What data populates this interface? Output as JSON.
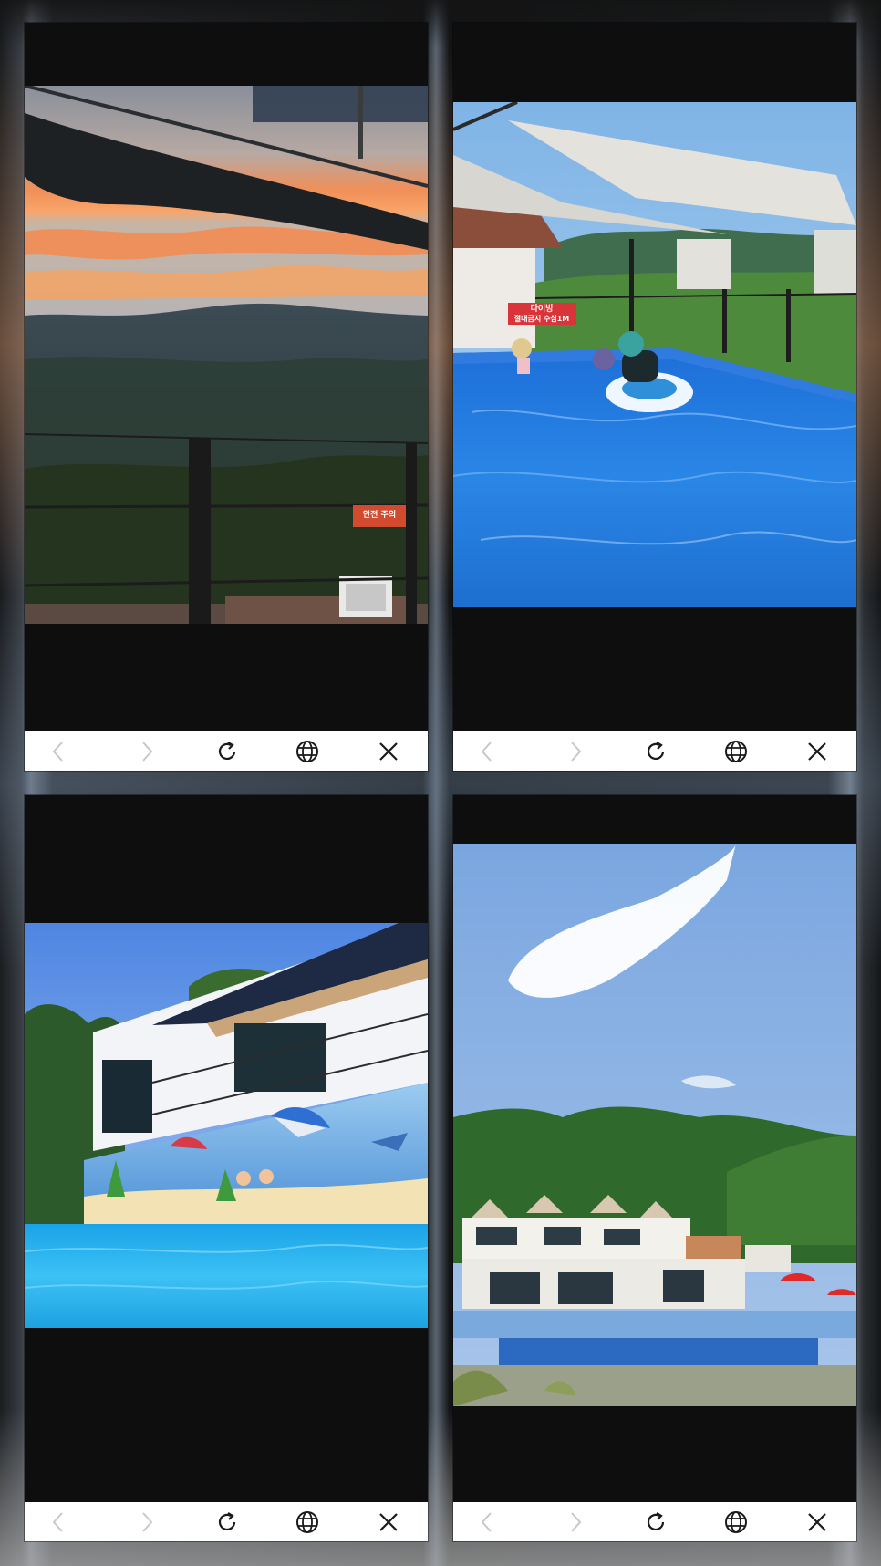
{
  "toolbar": {
    "back_icon": "chevron-left-icon",
    "forward_icon": "chevron-right-icon",
    "reload_icon": "reload-icon",
    "globe_icon": "globe-icon",
    "close_icon": "close-icon",
    "icon_color": "#1a1a1a",
    "disabled_color": "#c8c8c8"
  },
  "panels": [
    {
      "id": "sunset-mountain-view",
      "sign_text": "안전 주의"
    },
    {
      "id": "rooftop-pool",
      "sign_text_line1": "다이빙",
      "sign_text_line2": "절대금지  수심1M"
    },
    {
      "id": "mural-pool-building"
    },
    {
      "id": "pension-buildings-hillside"
    }
  ]
}
